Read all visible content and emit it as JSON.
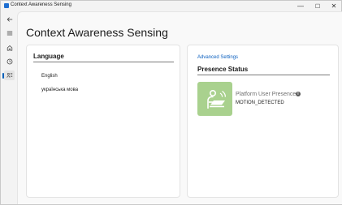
{
  "window": {
    "title": "Context Awareness Sensing",
    "controls": {
      "minimize": "—",
      "maximize": "☐",
      "close": "✕"
    }
  },
  "nav_rail": {
    "items": [
      {
        "icon": "back-arrow-icon"
      },
      {
        "icon": "hamburger-menu-icon"
      },
      {
        "icon": "home-icon"
      },
      {
        "icon": "history-icon"
      },
      {
        "icon": "sensing-settings-icon",
        "selected": true
      }
    ],
    "accent": "#005fb8"
  },
  "page": {
    "title": "Context Awareness Sensing"
  },
  "language_card": {
    "title": "Language",
    "options": [
      "English",
      "українська мова"
    ]
  },
  "presence_card": {
    "advanced_link": "Advanced Settings",
    "title": "Presence Status",
    "tile_color": "#a9d18e",
    "tile_icon": "person-at-laptop-icon",
    "label": "Platform User Presence",
    "info_icon": "info-icon",
    "value": "MOTION_DETECTED"
  }
}
